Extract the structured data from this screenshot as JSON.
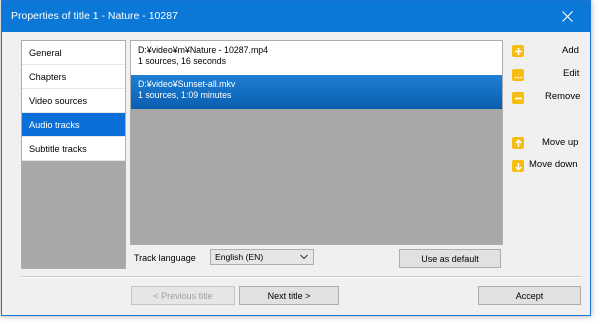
{
  "window": {
    "title": "Properties of title 1 - Nature - 10287"
  },
  "nav": {
    "items": [
      {
        "label": "General",
        "selected": false
      },
      {
        "label": "Chapters",
        "selected": false
      },
      {
        "label": "Video sources",
        "selected": false
      },
      {
        "label": "Audio tracks",
        "selected": true
      },
      {
        "label": "Subtitle tracks",
        "selected": false
      }
    ]
  },
  "tracks": [
    {
      "path": "D:¥video¥m¥Nature - 10287.mp4",
      "info": "1 sources, 16 seconds",
      "selected": false
    },
    {
      "path": "D:¥video¥Sunset-all.mkv",
      "info": "1 sources, 1:09 minutes",
      "selected": true
    }
  ],
  "actions": {
    "add": "Add",
    "edit": "Edit",
    "remove": "Remove",
    "move_up": "Move up",
    "move_down": "Move down"
  },
  "language": {
    "label": "Track language",
    "value": "English (EN)"
  },
  "buttons": {
    "use_default": "Use as default",
    "previous": "< Previous title",
    "next": "Next title >",
    "accept": "Accept"
  },
  "colors": {
    "titlebar": "#0b78d7",
    "selection": "#0a6fd8",
    "icon_accent": "#f6be12"
  },
  "icons": {
    "close": "close-icon",
    "add": "plus-icon",
    "edit": "ellipsis-icon",
    "remove": "minus-icon",
    "move_up": "arrow-up-icon",
    "move_down": "arrow-down-icon"
  }
}
